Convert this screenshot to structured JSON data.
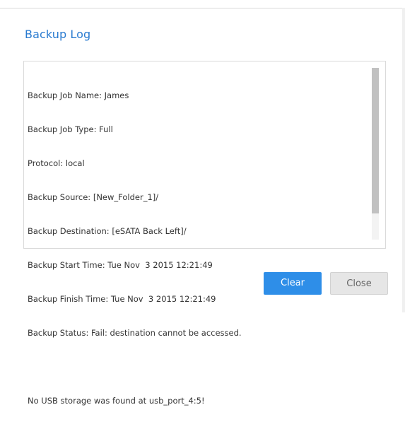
{
  "dialog": {
    "title": "Backup Log"
  },
  "log": {
    "lines": [
      "Backup Job Name: James",
      "Backup Job Type: Full",
      "Protocol: local",
      "Backup Source: [New_Folder_1]/",
      "Backup Destination: [eSATA Back Left]/",
      "Backup Start Time: Tue Nov  3 2015 12:21:49",
      "Backup Finish Time: Tue Nov  3 2015 12:21:49",
      "Backup Status: Fail: destination cannot be accessed.",
      "",
      "No USB storage was found at usb_port_4:5!"
    ]
  },
  "buttons": {
    "clear_label": "Clear",
    "close_label": "Close"
  },
  "colors": {
    "title": "#2a7bd0",
    "primary_button": "#2e8ee8",
    "secondary_button": "#e6e6e6"
  }
}
